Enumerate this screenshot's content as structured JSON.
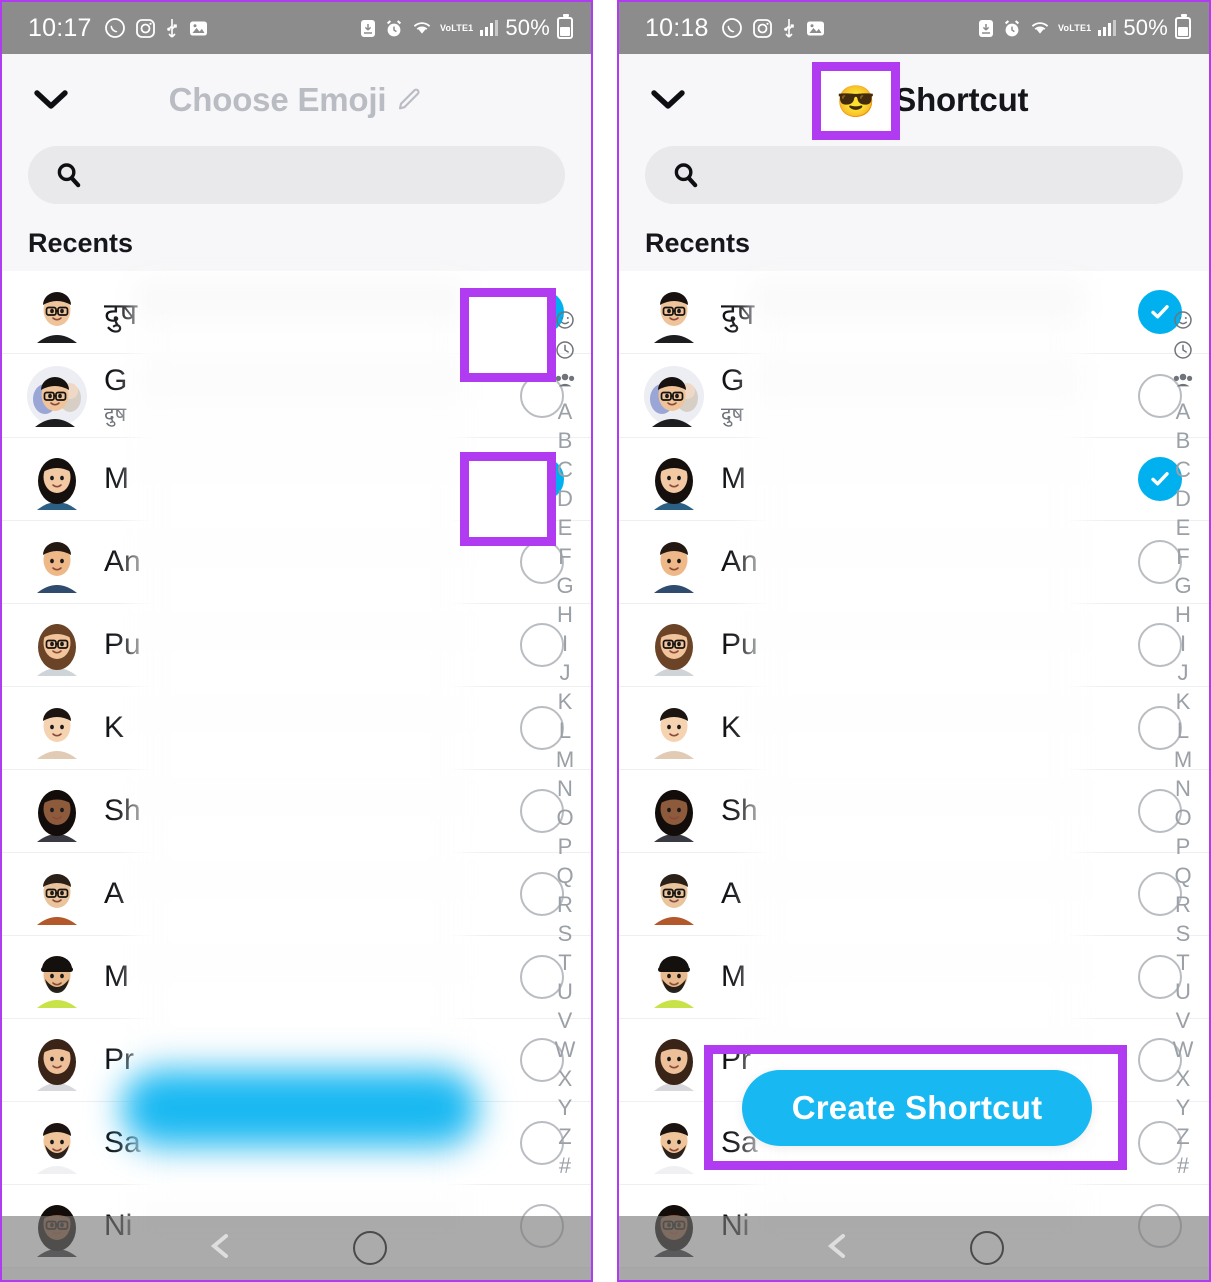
{
  "panels": [
    {
      "id": "left",
      "status": {
        "time": "10:17",
        "icons_left": [
          "whatsapp-icon",
          "instagram-icon",
          "usb-icon",
          "gallery-icon"
        ],
        "icons_right": [
          "download-icon",
          "alarm-icon",
          "wifi-icon"
        ],
        "network": "VoLTE1",
        "battery_percent": "50%"
      },
      "header": {
        "back_icon": "chevron-down-icon",
        "title": "Choose Emoji",
        "edit_icon": "pencil-icon",
        "emoji": "",
        "muted": true
      },
      "search": {
        "placeholder": "",
        "value": "",
        "icon": "search-icon"
      },
      "section_label": "Recents",
      "cta": {
        "label": "Create Shortcut",
        "blurred": true
      },
      "highlights": [
        "checkbox-row-1",
        "checkbox-row-3"
      ]
    },
    {
      "id": "right",
      "status": {
        "time": "10:18",
        "icons_left": [
          "whatsapp-icon",
          "instagram-icon",
          "usb-icon",
          "gallery-icon"
        ],
        "icons_right": [
          "download-icon",
          "alarm-icon",
          "wifi-icon"
        ],
        "network": "VoLTE1",
        "battery_percent": "50%"
      },
      "header": {
        "back_icon": "chevron-down-icon",
        "title": "Shortcut",
        "edit_icon": "",
        "emoji": "😎",
        "muted": false
      },
      "search": {
        "placeholder": "",
        "value": "",
        "icon": "search-icon"
      },
      "section_label": "Recents",
      "cta": {
        "label": "Create Shortcut",
        "blurred": false
      },
      "highlights": [
        "header-emoji",
        "create-shortcut-button"
      ]
    }
  ],
  "contacts": [
    {
      "name": "दुष",
      "subtitle": "",
      "checked": true,
      "avatar": "man-glasses-black-shirt"
    },
    {
      "name": "G",
      "subtitle": "दुष",
      "checked": false,
      "avatar": "group-avatar"
    },
    {
      "name": "M",
      "subtitle": "",
      "checked": true,
      "avatar": "woman-long-hair-blue"
    },
    {
      "name": "An",
      "subtitle": "",
      "checked": false,
      "avatar": "man-short-hair-navy"
    },
    {
      "name": "Pu",
      "subtitle": "",
      "checked": false,
      "avatar": "woman-wavy-hair-glasses"
    },
    {
      "name": "K",
      "subtitle": "",
      "checked": false,
      "avatar": "man-light-skin-tan"
    },
    {
      "name": "Sh",
      "subtitle": "",
      "checked": false,
      "avatar": "woman-curly-dark-hair"
    },
    {
      "name": "A",
      "subtitle": "",
      "checked": false,
      "avatar": "man-glasses-orange-shirt"
    },
    {
      "name": "M",
      "subtitle": "",
      "checked": false,
      "avatar": "man-beard-cap-green"
    },
    {
      "name": "Pr",
      "subtitle": "",
      "checked": false,
      "avatar": "woman-smiling-wavy-hair"
    },
    {
      "name": "Sa",
      "subtitle": "",
      "checked": false,
      "avatar": "man-beard-wink"
    },
    {
      "name": "Ni",
      "subtitle": "",
      "checked": false,
      "avatar": "woman-glasses-dark-hair"
    }
  ],
  "alpha_index": [
    "smiley-icon",
    "clock-icon",
    "group-icon",
    "A",
    "B",
    "C",
    "D",
    "E",
    "F",
    "G",
    "H",
    "I",
    "J",
    "K",
    "L",
    "M",
    "N",
    "O",
    "P",
    "Q",
    "R",
    "S",
    "T",
    "U",
    "V",
    "W",
    "X",
    "Y",
    "Z",
    "#"
  ],
  "colors": {
    "highlight_purple": "#b13bf0",
    "accent_blue": "#00b0ef",
    "cta_blue": "#18b8f2",
    "statusbar_gray": "#8c8c8c",
    "panel_bg": "#f7f7f9",
    "search_bg": "#e9e9ec",
    "title_muted": "#b9bcc2"
  },
  "navbar": {
    "back_icon": "back-chevron-icon",
    "home_icon": "home-circle-icon"
  }
}
